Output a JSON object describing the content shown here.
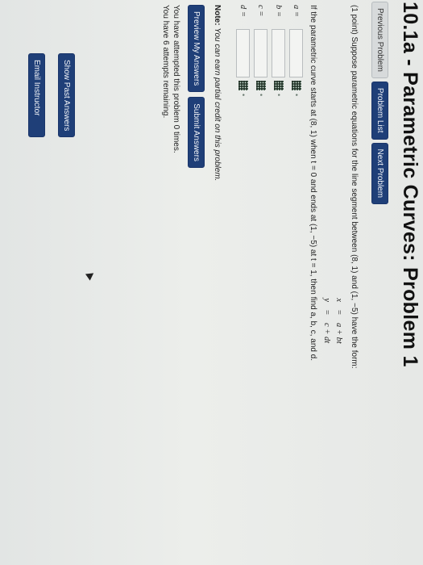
{
  "page": {
    "title": "10.1a - Parametric Curves: Problem 1"
  },
  "nav": {
    "previous": "Previous Problem",
    "list": "Problem List",
    "next": "Next Problem"
  },
  "problem": {
    "intro": "(1 point) Suppose parametric equations for the line segment between (8, 1) and (1, −5) have the form:",
    "equations": [
      {
        "lhs": "x",
        "eq": "=",
        "rhs": "a + bt"
      },
      {
        "lhs": "y",
        "eq": "=",
        "rhs": "c + dt"
      }
    ],
    "question": "If the parametric curve starts at (8, 1) when t = 0 and ends at (1, −5) at t = 1, then find a, b, c, and d.",
    "answers": [
      {
        "label": "a =",
        "value": ""
      },
      {
        "label": "b =",
        "value": ""
      },
      {
        "label": "c =",
        "value": ""
      },
      {
        "label": "d =",
        "value": ""
      }
    ],
    "note_label": "Note:",
    "note_text": "You can earn partial credit on this problem."
  },
  "actions": {
    "preview": "Preview My Answers",
    "submit": "Submit Answers"
  },
  "status": {
    "attempted": "You have attempted this problem 0 times.",
    "remaining": "You have 6 attempts remaining."
  },
  "side": {
    "show_past": "Show Past Answers",
    "email": "Email Instructor"
  },
  "icons": {
    "matrix": "grid-icon"
  }
}
